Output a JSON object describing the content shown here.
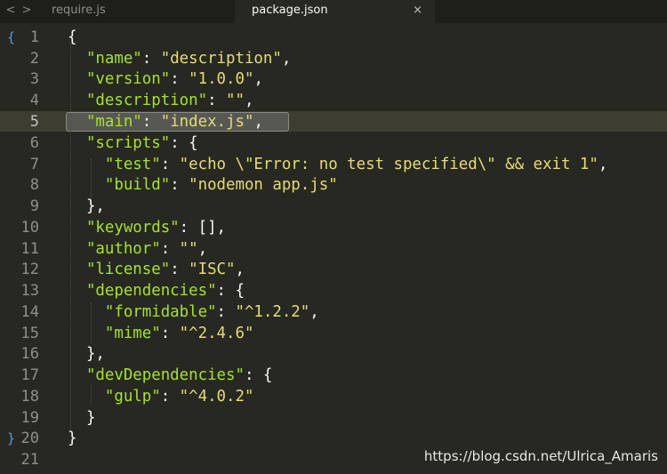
{
  "tabs": [
    {
      "label": "require.js"
    },
    {
      "label": "package.json",
      "active": true
    }
  ],
  "tab_close_glyph": "×",
  "nav": {
    "back_glyph": "<",
    "forward_glyph": ">"
  },
  "gutter": {
    "line_numbers": [
      "1",
      "2",
      "3",
      "4",
      "5",
      "6",
      "7",
      "8",
      "9",
      "10",
      "11",
      "12",
      "13",
      "14",
      "15",
      "16",
      "17",
      "18",
      "19",
      "20",
      "21"
    ],
    "fold_open": "{",
    "fold_close": "}",
    "current_line": "5"
  },
  "code": {
    "l1": {
      "a": "{"
    },
    "l2": {
      "k": "\"name\"",
      "p": ": ",
      "v": "\"description\"",
      "e": ","
    },
    "l3": {
      "k": "\"version\"",
      "p": ": ",
      "v": "\"1.0.0\"",
      "e": ","
    },
    "l4": {
      "k": "\"description\"",
      "p": ": ",
      "v": "\"\"",
      "e": ","
    },
    "l5": {
      "k": "\"main\"",
      "p": ": ",
      "v": "\"index.js\"",
      "e": ","
    },
    "l6": {
      "k": "\"scripts\"",
      "p": ": {"
    },
    "l7": {
      "k": "\"test\"",
      "p": ": ",
      "v": "\"echo \\\"Error: no test specified\\\" && exit 1\"",
      "e": ","
    },
    "l8": {
      "k": "\"build\"",
      "p": ": ",
      "v": "\"nodemon app.js\""
    },
    "l9": {
      "a": "},"
    },
    "l10": {
      "k": "\"keywords\"",
      "p": ": [],"
    },
    "l11": {
      "k": "\"author\"",
      "p": ": ",
      "v": "\"\"",
      "e": ","
    },
    "l12": {
      "k": "\"license\"",
      "p": ": ",
      "v": "\"ISC\"",
      "e": ","
    },
    "l13": {
      "k": "\"dependencies\"",
      "p": ": {"
    },
    "l14": {
      "k": "\"formidable\"",
      "p": ": ",
      "v": "\"^1.2.2\"",
      "e": ","
    },
    "l15": {
      "k": "\"mime\"",
      "p": ": ",
      "v": "\"^2.4.6\""
    },
    "l16": {
      "a": "},"
    },
    "l17": {
      "k": "\"devDependencies\"",
      "p": ": {"
    },
    "l18": {
      "k": "\"gulp\"",
      "p": ": ",
      "v": "\"^4.0.2\""
    },
    "l19": {
      "a": "}"
    },
    "l20": {
      "a": "}"
    }
  },
  "watermark": "https://blog.csdn.net/Ulrica_Amaris",
  "colors": {
    "background": "#272822",
    "key": "#a6e22e",
    "string": "#e6db74",
    "punctuation": "#f8f8f2",
    "line_number": "#90908a",
    "fold_marker": "#5b9bd5"
  }
}
